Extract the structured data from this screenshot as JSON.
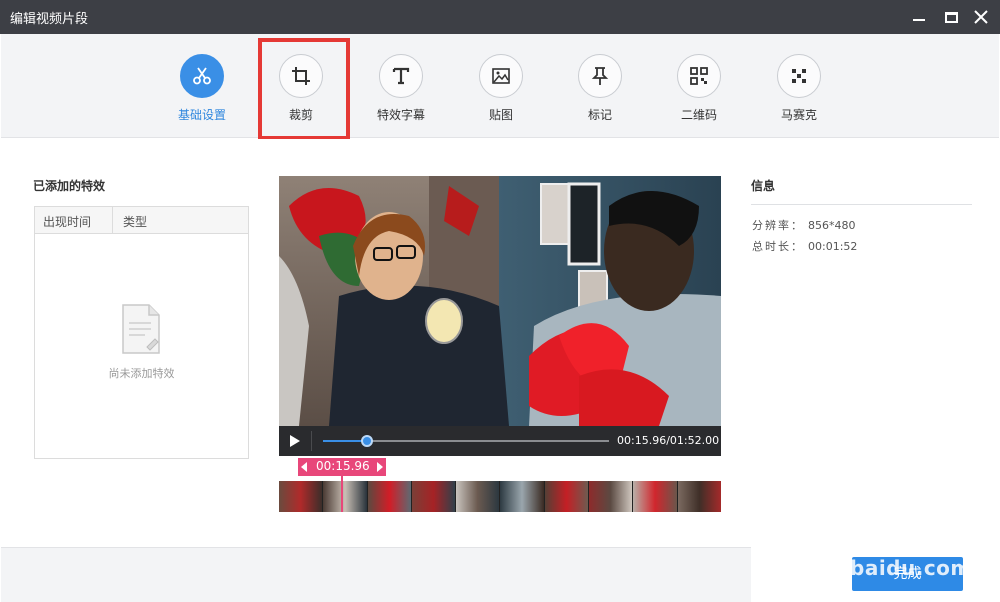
{
  "window": {
    "title": "编辑视频片段"
  },
  "toolbar": {
    "tools": [
      {
        "label": "基础设置",
        "icon": "scissors-icon"
      },
      {
        "label": "裁剪",
        "icon": "crop-icon"
      },
      {
        "label": "特效字幕",
        "icon": "text-icon"
      },
      {
        "label": "贴图",
        "icon": "image-icon"
      },
      {
        "label": "标记",
        "icon": "pin-icon"
      },
      {
        "label": "二维码",
        "icon": "qrcode-icon"
      },
      {
        "label": "马赛克",
        "icon": "mosaic-icon"
      }
    ],
    "active_tool": "基础设置",
    "highlighted_tool": "裁剪"
  },
  "effects_panel": {
    "title": "已添加的特效",
    "columns": [
      "出现时间",
      "类型"
    ],
    "empty_text": "尚未添加特效"
  },
  "player": {
    "time_display": "00:15.96/01:52.00",
    "progress": 0.153
  },
  "timeline": {
    "marker_time": "00:15.96"
  },
  "info": {
    "title": "信息",
    "resolution_label": "分辨率：",
    "resolution_value": "856*480",
    "duration_label": "总时长：",
    "duration_value": "00:01:52"
  },
  "footer": {
    "done_label": "完成",
    "watermark": "baidu.com"
  },
  "colors": {
    "accent": "#2e8ae6",
    "titlebar": "#3d3f45",
    "highlight": "#e53935",
    "marker": "#e8477a"
  }
}
